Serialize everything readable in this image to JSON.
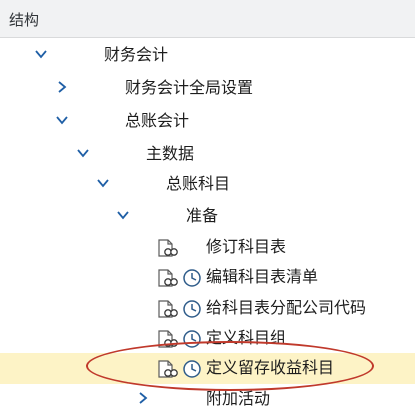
{
  "header": {
    "title": "结构"
  },
  "tree": [
    {
      "label": "财务会计"
    },
    {
      "label": "财务会计全局设置"
    },
    {
      "label": "总账会计"
    },
    {
      "label": "主数据"
    },
    {
      "label": "总账科目"
    },
    {
      "label": "准备"
    },
    {
      "label": "修订科目表"
    },
    {
      "label": "编辑科目表清单"
    },
    {
      "label": "给科目表分配公司代码"
    },
    {
      "label": "定义科目组"
    },
    {
      "label": "定义留存收益科目"
    },
    {
      "label": "附加活动"
    }
  ],
  "colors": {
    "selected_row": "#fdf3c6",
    "highlight_oval": "#c0392b",
    "chevron": "#1f5fa6"
  }
}
